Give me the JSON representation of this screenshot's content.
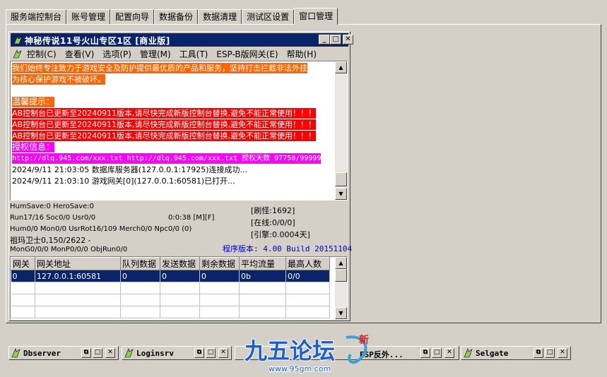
{
  "tabs": [
    "服务端控制台",
    "账号管理",
    "配置向导",
    "数据备份",
    "数据清理",
    "测试区设置",
    "窗口管理"
  ],
  "active_tab": 6,
  "window": {
    "title": "神秘传说11号火山专区1区 [商业版]",
    "menu": [
      "控制(C)",
      "查看(V)",
      "选项(P)",
      "管理(M)",
      "工具(T)",
      "ESP-B版网关(E)",
      "帮助(H)"
    ]
  },
  "log": {
    "line1": "我们始终专注致力于游戏安全及防护提供最优质的产品和服务，坚持打击拦截非法外挂",
    "line2": "为核心保护游戏不被破坏。",
    "tips_title": "温馨提示：",
    "warn1": "AB控制台已更新至20240911版本,请尽快完成新版控制台替换,避免不能正常使用！！！",
    "warn2": "AB控制台已更新至20240911版本,请尽快完成新版控制台替换,避免不能正常使用！！！",
    "warn3": "AB控制台已更新至20240911版本,请尽快完成新版控制台替换,避免不能正常使用！！！",
    "auth_title": "授权信息：",
    "auth_line": "http://dlq.945.com/xxx.txt http://dlq.945.com/xxx.txt 授权天数 97750/99999",
    "evt1": "2024/9/11 21:03:05 数据库服务器(127.0.0.1:17925)连接成功...",
    "evt2": "2024/9/11 21:03:10 游戏网关[0](127.0.0.1:60581)已打开..."
  },
  "status": {
    "save": "HumSave:0 HeroSave:0",
    "run": "Run17/16 Soc0/0 Usr0/0",
    "timer": "0:0:38 [M][F]",
    "hum": "Hum0/0 Mon0/0 UsrRot16/109 Merch0/0 Npc0/0 (0)",
    "guard": "祖玛卫士0,150/2622 -",
    "mon": "MonG0/0/0 MonP0/0/0 ObjRun0/0",
    "refresh": "[刷怪:1692]",
    "online": "[在线:0/0/0]",
    "engine": "[引擎:0.0004天]",
    "version": "程序版本: 4.00 Build 20151104"
  },
  "grid": {
    "headers": [
      "网关",
      "网关地址",
      "队列数据",
      "发送数据",
      "剩余数据",
      "平均流量",
      "最高人数"
    ],
    "rows": [
      [
        "0",
        "127.0.0.1:60581",
        "0",
        "0",
        "0",
        "0b",
        "0/0"
      ]
    ]
  },
  "minimized": [
    "Dbserver",
    "Loginsrv",
    "ESP反外...",
    "Selgate"
  ],
  "watermark": {
    "logo": "九五论坛",
    "url": "www.95gm.com",
    "badge": "新"
  }
}
